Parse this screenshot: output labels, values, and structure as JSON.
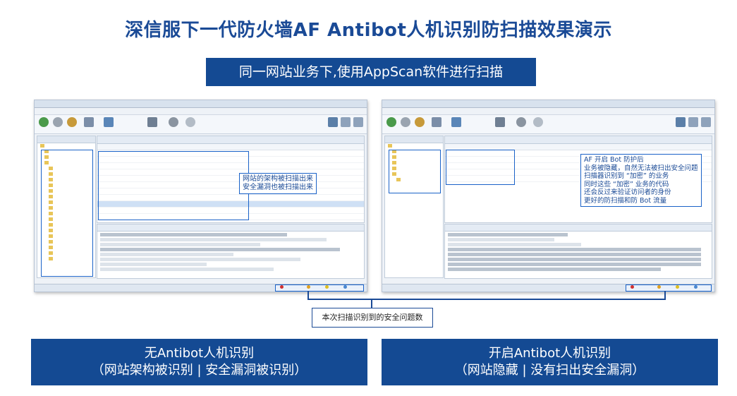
{
  "title": "深信服下一代防火墙AF Antibot人机识别防扫描效果演示",
  "subtitle": "同一网站业务下,使用AppScan软件进行扫描",
  "left_screenshot": {
    "callout": [
      "网站的架构被扫描出来",
      "安全漏洞也被扫描出来"
    ]
  },
  "right_screenshot": {
    "callout": [
      "AF 开启 Bot 防护后",
      "业务被隐藏，自然无法被扫出安全问题",
      "扫描器识别到 “加密” 的业务",
      "同时这些 “加密” 业务的代码",
      "还会反过来验证访问者的身份",
      "更好的防扫描和防 Bot 流量"
    ]
  },
  "note": "本次扫描识别到的安全问题数",
  "bottom_left": {
    "line1": "无Antibot人机识别",
    "line2": "（网站架构被识别 | 安全漏洞被识别）"
  },
  "bottom_right": {
    "line1": "开启Antibot人机识别",
    "line2": "（网站隐藏 | 没有扫出安全漏洞）"
  },
  "colors": {
    "brand": "#144a93",
    "title": "#1a4a96",
    "highlight": "#1a62c8"
  }
}
